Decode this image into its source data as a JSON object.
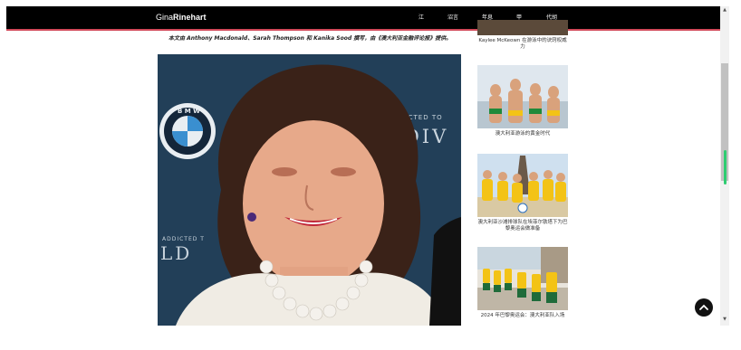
{
  "header": {
    "brand_part1": "Gina",
    "brand_part2": "Rinehart",
    "nav": [
      "江",
      "沼言",
      "年息",
      "甲",
      "代胡"
    ]
  },
  "article": {
    "credit": "本文由 Anthony Macdonald、Sarah Thompson 和 Kanika Sood 撰写，由《澳大利亚金融评论报》提供。",
    "hero_alt": "",
    "backdrop_text_1": "ADDICTED TO",
    "backdrop_text_2": "LDIV",
    "backdrop_text_3": "ADDICTED T",
    "backdrop_text_4": "LD"
  },
  "sidebar": {
    "items": [
      {
        "caption": "Kaylee McKeown 在游泳中的诀窍权威力"
      },
      {
        "caption": "澳大利亚游泳的黄金时代"
      },
      {
        "caption": "澳大利亚沙滩排球队在埃菲尔铁塔下为巴黎奥运会做准备"
      },
      {
        "caption": "2024 年巴黎奥运会：澳大利亚队入场"
      }
    ]
  },
  "colors": {
    "topbar": "#000000",
    "accent_line": "#d24a5a",
    "scroll_indicator": "#2ecc71"
  }
}
